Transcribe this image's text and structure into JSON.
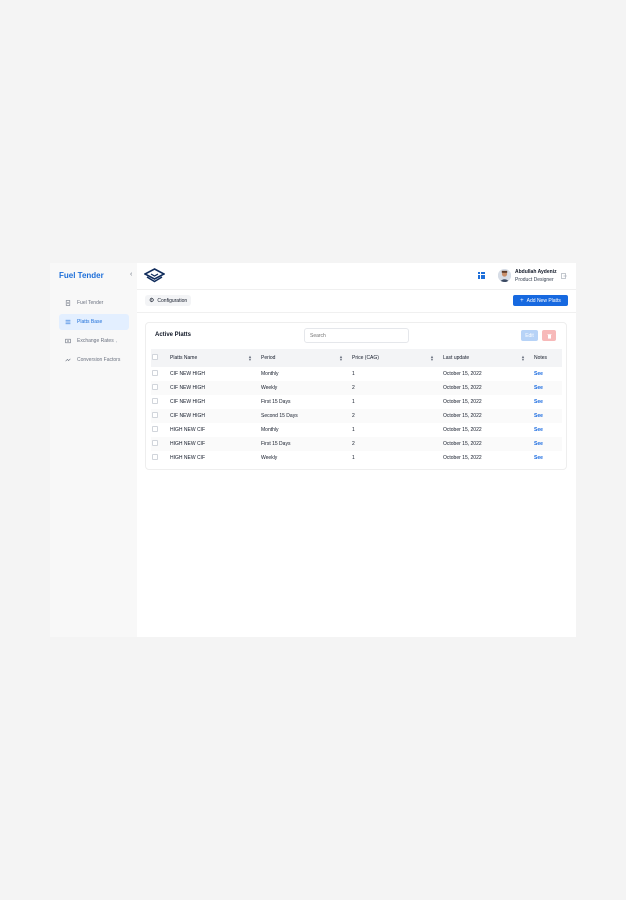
{
  "sidebar": {
    "brand": "Fuel Tender",
    "items": [
      {
        "label": "Fuel Tender",
        "icon": "document-icon",
        "active": false
      },
      {
        "label": "Platts Base",
        "icon": "list-icon",
        "active": true
      },
      {
        "label": "Exchange Rates",
        "icon": "exchange-icon",
        "active": false,
        "has_submenu": true
      },
      {
        "label": "Conversion Factors",
        "icon": "trend-icon",
        "active": false
      }
    ]
  },
  "header": {
    "user_name": "Abdullah Aydeniz",
    "user_role": "Product Designer"
  },
  "toolbar": {
    "config_label": "Configuration",
    "add_button_label": "Add New Platts"
  },
  "table_card": {
    "title": "Active Platts",
    "search_placeholder": "Search",
    "edit_label": "Edit",
    "columns": [
      "Platts Name",
      "Period",
      "Price (CAG)",
      "Last update",
      "Notes"
    ],
    "rows": [
      {
        "name": "CIF NEW HIGH",
        "period": "Monthly",
        "price": "1",
        "updated": "October 15, 2022",
        "notes": "See"
      },
      {
        "name": "CIF NEW HIGH",
        "period": "Weekly",
        "price": "2",
        "updated": "October 15, 2022",
        "notes": "See"
      },
      {
        "name": "CIF NEW HIGH",
        "period": "First 15 Days",
        "price": "1",
        "updated": "October 15, 2022",
        "notes": "See"
      },
      {
        "name": "CIF NEW HIGH",
        "period": "Second 15 Days",
        "price": "2",
        "updated": "October 15, 2022",
        "notes": "See"
      },
      {
        "name": "HIGH NEW CIF",
        "period": "Monthly",
        "price": "1",
        "updated": "October 15, 2022",
        "notes": "See"
      },
      {
        "name": "HIGH NEW CIF",
        "period": "First 15 Days",
        "price": "2",
        "updated": "October 15, 2022",
        "notes": "See"
      },
      {
        "name": "HIGH NEW CIF",
        "period": "Weekly",
        "price": "1",
        "updated": "October 15, 2022",
        "notes": "See"
      }
    ]
  },
  "colors": {
    "accent": "#1769e0",
    "brand": "#1e6fd9",
    "danger_light": "#f7b9b9",
    "accent_light": "#b7d3f7"
  }
}
